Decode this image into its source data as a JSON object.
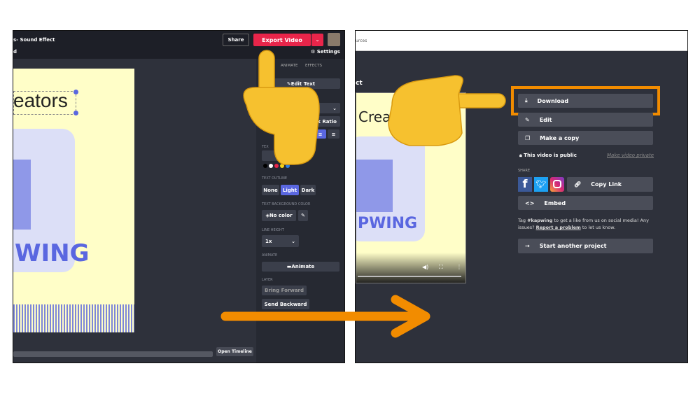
{
  "editor": {
    "title": "s- Sound Effect",
    "subtitle": "d",
    "share": "Share",
    "export": "Export Video",
    "settings": "Settings",
    "tabs": [
      "ANIMATE",
      "EFFECTS"
    ],
    "edit_text": "Edit Text",
    "lock_ratio": "ock Ratio",
    "canvas_text": "eators",
    "logo_text": "WING",
    "text_color_label": "TEX",
    "outline_label": "TEXT OUTLINE",
    "outline_options": [
      "None",
      "Light",
      "Dark"
    ],
    "bg_color_label": "TEXT BACKGROUND COLOR",
    "no_color": "No color",
    "line_height_label": "LINE HEIGHT",
    "line_height": "1x",
    "animate_label": "ANIMATE",
    "animate_button": "Animate",
    "layer_label": "LAYER",
    "bring_forward": "Bring Forward",
    "send_backward": "Send Backward",
    "open_timeline": "Open Timeline",
    "swatches": [
      "#000000",
      "#ffffff",
      "#e8254a",
      "#f2d21b",
      "#2f7fe0"
    ]
  },
  "result": {
    "topbar_text": "urces",
    "heading": "ct",
    "video_text": "Crea",
    "logo_text": "PWING",
    "download": "Download",
    "edit": "Edit",
    "copy": "Make a copy",
    "public": "This video is public",
    "make_private": "Make video private",
    "share_label": "SHARE",
    "copy_link": "Copy Link",
    "embed": "Embed",
    "tag_pre": "Tag ",
    "tag": "#kapwing",
    "tag_post": " to get a like from us on social media! Any issues? ",
    "report": "Report a problem",
    "report_post": " to let us know.",
    "start": "Start another project"
  },
  "colors": {
    "accent": "#e8254a",
    "highlight": "#f28c00",
    "brand": "#5a67e0"
  }
}
